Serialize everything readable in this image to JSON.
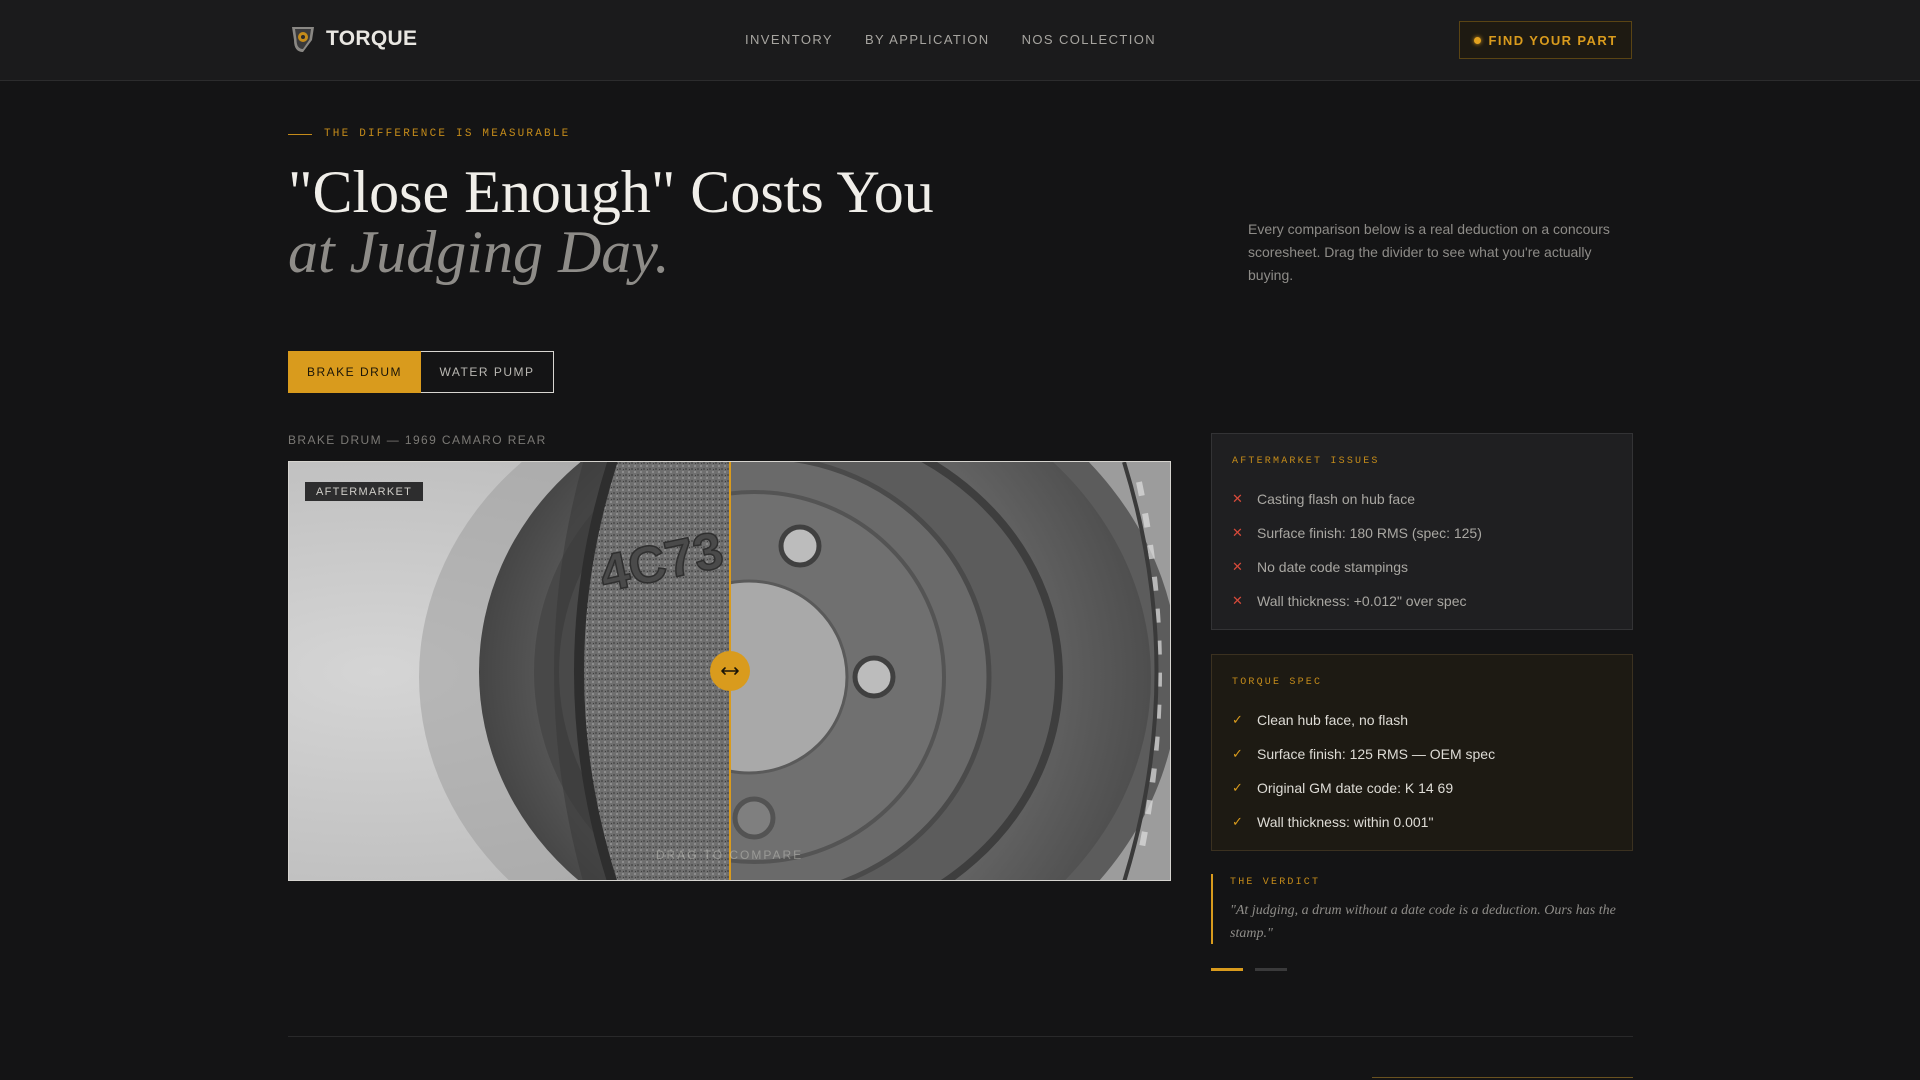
{
  "header": {
    "brand": "TORQUE",
    "nav": [
      "INVENTORY",
      "BY APPLICATION",
      "NOS COLLECTION"
    ],
    "cta_label": "FIND YOUR PART",
    "accent_color": "#d99b1d"
  },
  "hero": {
    "eyebrow": "THE DIFFERENCE IS MEASURABLE",
    "title": "\"Close Enough\" Costs You",
    "title_italic": "at Judging Day.",
    "description": "Every comparison below is a real deduction on a concours scoresheet. Drag the divider to see what you're actually buying."
  },
  "tabs": [
    {
      "label": "BRAKE DRUM",
      "active": true
    },
    {
      "label": "WATER PUMP",
      "active": false
    }
  ],
  "comparison": {
    "label": "BRAKE DRUM — 1969 CAMARO REAR",
    "badge": "AFTERMARKET",
    "casting_text": "4C73",
    "hint": "DRAG TO COMPARE",
    "divider_position": 0.5,
    "handle_icon": "drag-horizontal-icon"
  },
  "issues": {
    "heading": "AFTERMARKET ISSUES",
    "items": [
      "Casting flash on hub face",
      "Surface finish: 180 RMS (spec: 125)",
      "No date code stampings",
      "Wall thickness: +0.012\" over spec"
    ]
  },
  "spec": {
    "heading": "TORQUE SPEC",
    "items": [
      "Clean hub face, no flash",
      "Surface finish: 125 RMS — OEM spec",
      "Original GM date code: K 14 69",
      "Wall thickness: within 0.001\""
    ]
  },
  "verdict": {
    "heading": "THE VERDICT",
    "quote": "\"At judging, a drum without a date code is a deduction. Ours has the stamp.\""
  },
  "pager": {
    "count": 2,
    "active_index": 0
  },
  "icons": {
    "x_mark": "✕",
    "check_mark": "✓"
  }
}
